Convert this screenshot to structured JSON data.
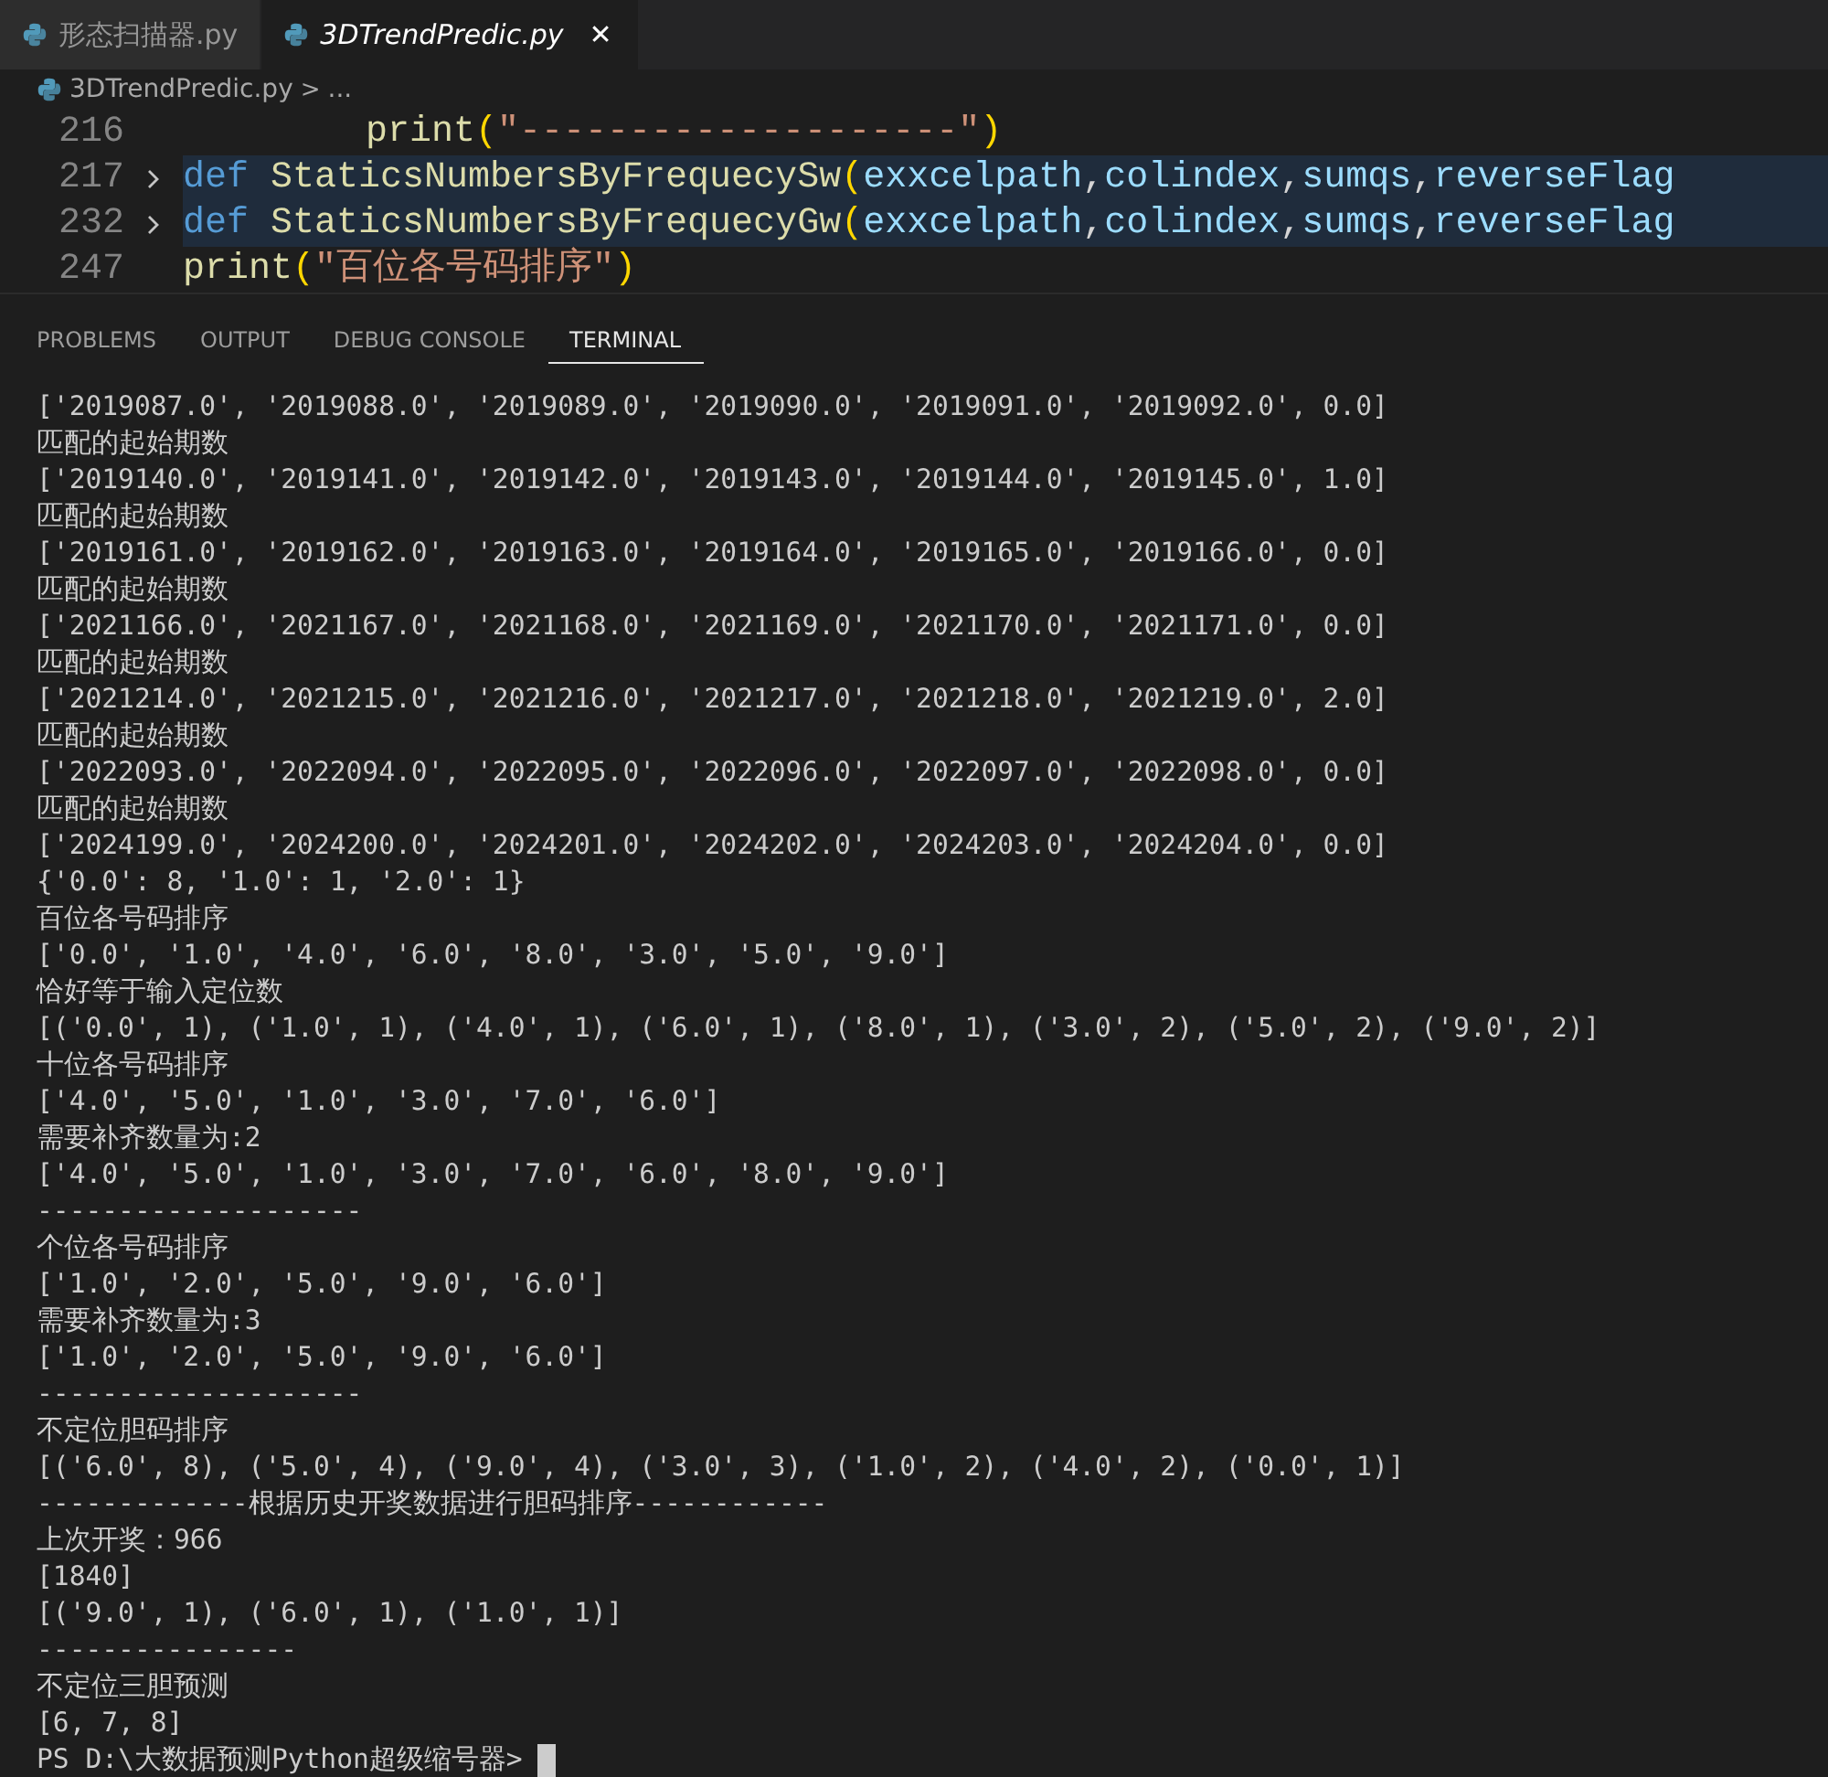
{
  "editor_tabs": [
    {
      "label": "形态扫描器.py",
      "selected": false
    },
    {
      "label": "3DTrendPredic.py",
      "selected": true,
      "close": "✕"
    }
  ],
  "breadcrumb": {
    "file": "3DTrendPredic.py",
    "separator": ">",
    "more": "..."
  },
  "code_lines": [
    {
      "number": "216",
      "folded": false,
      "highlighted": false,
      "indent": true,
      "tokens": [
        {
          "kind": "func",
          "text": "print"
        },
        {
          "kind": "paren",
          "text": "("
        },
        {
          "kind": "string",
          "text": "\"--------------------\""
        },
        {
          "kind": "paren",
          "text": ")"
        }
      ]
    },
    {
      "number": "217",
      "folded": true,
      "highlighted": true,
      "indent": false,
      "tokens": [
        {
          "kind": "keyword",
          "text": "def "
        },
        {
          "kind": "func",
          "text": "StaticsNumbersByFrequecySw"
        },
        {
          "kind": "paren",
          "text": "("
        },
        {
          "kind": "param",
          "text": "exxcelpath"
        },
        {
          "kind": "plain",
          "text": ","
        },
        {
          "kind": "param",
          "text": "colindex"
        },
        {
          "kind": "plain",
          "text": ","
        },
        {
          "kind": "param",
          "text": "sumqs"
        },
        {
          "kind": "plain",
          "text": ","
        },
        {
          "kind": "param",
          "text": "reverseFlag"
        }
      ]
    },
    {
      "number": "232",
      "folded": true,
      "highlighted": true,
      "indent": false,
      "tokens": [
        {
          "kind": "keyword",
          "text": "def "
        },
        {
          "kind": "func",
          "text": "StaticsNumbersByFrequecyGw"
        },
        {
          "kind": "paren",
          "text": "("
        },
        {
          "kind": "param",
          "text": "exxcelpath"
        },
        {
          "kind": "plain",
          "text": ","
        },
        {
          "kind": "param",
          "text": "colindex"
        },
        {
          "kind": "plain",
          "text": ","
        },
        {
          "kind": "param",
          "text": "sumqs"
        },
        {
          "kind": "plain",
          "text": ","
        },
        {
          "kind": "param",
          "text": "reverseFlag"
        }
      ]
    },
    {
      "number": "247",
      "folded": false,
      "highlighted": false,
      "indent": false,
      "tokens": [
        {
          "kind": "func",
          "text": "print"
        },
        {
          "kind": "paren",
          "text": "("
        },
        {
          "kind": "string",
          "text": "\"百位各号码排序\""
        },
        {
          "kind": "paren",
          "text": ")"
        }
      ]
    }
  ],
  "panel_tabs": [
    {
      "label": "PROBLEMS",
      "selected": false
    },
    {
      "label": "OUTPUT",
      "selected": false
    },
    {
      "label": "DEBUG CONSOLE",
      "selected": false
    },
    {
      "label": "TERMINAL",
      "selected": true
    }
  ],
  "terminal_lines": [
    "['2019087.0', '2019088.0', '2019089.0', '2019090.0', '2019091.0', '2019092.0', 0.0]",
    "匹配的起始期数",
    "['2019140.0', '2019141.0', '2019142.0', '2019143.0', '2019144.0', '2019145.0', 1.0]",
    "匹配的起始期数",
    "['2019161.0', '2019162.0', '2019163.0', '2019164.0', '2019165.0', '2019166.0', 0.0]",
    "匹配的起始期数",
    "['2021166.0', '2021167.0', '2021168.0', '2021169.0', '2021170.0', '2021171.0', 0.0]",
    "匹配的起始期数",
    "['2021214.0', '2021215.0', '2021216.0', '2021217.0', '2021218.0', '2021219.0', 2.0]",
    "匹配的起始期数",
    "['2022093.0', '2022094.0', '2022095.0', '2022096.0', '2022097.0', '2022098.0', 0.0]",
    "匹配的起始期数",
    "['2024199.0', '2024200.0', '2024201.0', '2024202.0', '2024203.0', '2024204.0', 0.0]",
    "{'0.0': 8, '1.0': 1, '2.0': 1}",
    "百位各号码排序",
    "['0.0', '1.0', '4.0', '6.0', '8.0', '3.0', '5.0', '9.0']",
    "恰好等于输入定位数",
    "[('0.0', 1), ('1.0', 1), ('4.0', 1), ('6.0', 1), ('8.0', 1), ('3.0', 2), ('5.0', 2), ('9.0', 2)]",
    "十位各号码排序",
    "['4.0', '5.0', '1.0', '3.0', '7.0', '6.0']",
    "需要补齐数量为:2",
    "['4.0', '5.0', '1.0', '3.0', '7.0', '6.0', '8.0', '9.0']",
    "--------------------",
    "个位各号码排序",
    "['1.0', '2.0', '5.0', '9.0', '6.0']",
    "需要补齐数量为:3",
    "['1.0', '2.0', '5.0', '9.0', '6.0']",
    "--------------------",
    "不定位胆码排序",
    "[('6.0', 8), ('5.0', 4), ('9.0', 4), ('3.0', 3), ('1.0', 2), ('4.0', 2), ('0.0', 1)]",
    "-------------根据历史开奖数据进行胆码排序------------",
    "上次开奖：966",
    "[1840]",
    "[('9.0', 1), ('6.0', 1), ('1.0', 1)]",
    "----------------",
    "不定位三胆预测",
    "[6, 7, 8]"
  ],
  "prompt": "PS D:\\大数据预测Python超级缩号器>"
}
